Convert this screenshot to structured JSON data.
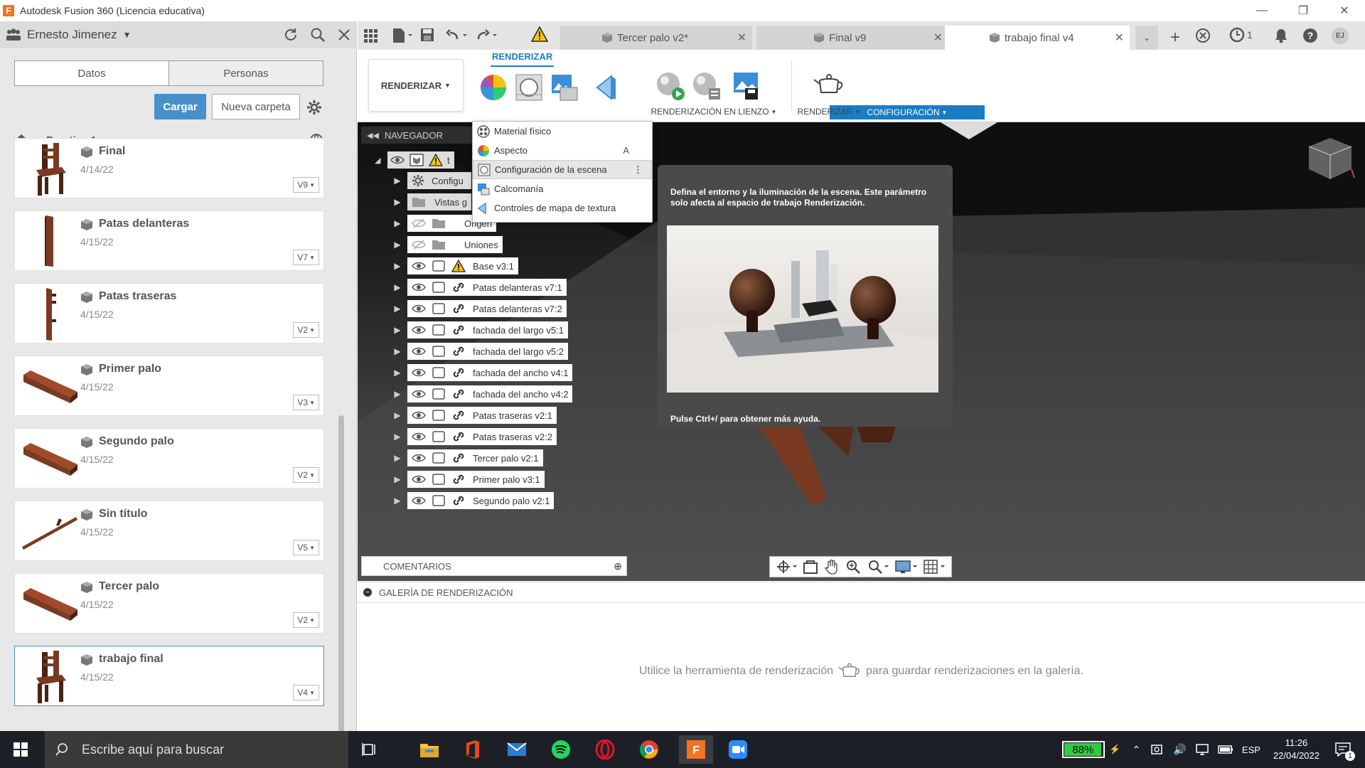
{
  "window": {
    "title": "Autodesk Fusion 360 (Licencia educativa)",
    "logo": "F"
  },
  "left": {
    "user": "Ernesto Jimenez",
    "tabs": [
      "Datos",
      "Personas"
    ],
    "upload_label": "Cargar",
    "new_folder_label": "Nueva carpeta",
    "breadcrumb": "Practica 1",
    "files": [
      {
        "name": "Final",
        "date": "4/14/22",
        "version": "V9",
        "thumb": "chair"
      },
      {
        "name": "Patas delanteras",
        "date": "4/15/22",
        "version": "V7",
        "thumb": "leg"
      },
      {
        "name": "Patas traseras",
        "date": "4/15/22",
        "version": "V2",
        "thumb": "backleg"
      },
      {
        "name": "Primer palo",
        "date": "4/15/22",
        "version": "V3",
        "thumb": "beam"
      },
      {
        "name": "Segundo palo",
        "date": "4/15/22",
        "version": "V2",
        "thumb": "beam"
      },
      {
        "name": "Sin título",
        "date": "4/15/22",
        "version": "V5",
        "thumb": "stick"
      },
      {
        "name": "Tercer palo",
        "date": "4/15/22",
        "version": "V2",
        "thumb": "beam"
      },
      {
        "name": "trabajo final",
        "date": "4/15/22",
        "version": "V4",
        "thumb": "chair"
      }
    ]
  },
  "doc_tabs": [
    {
      "label": "Tercer palo v2*",
      "active": false
    },
    {
      "label": "Final v9",
      "active": false
    },
    {
      "label": "trabajo final v4",
      "active": true
    }
  ],
  "header_icons": {
    "job_status_count": "1",
    "user_initials": "EJ"
  },
  "ribbon": {
    "workspace": "RENDERIZAR",
    "tab": "RENDERIZAR",
    "groups": [
      "CONFIGURACIÓN",
      "RENDERIZACIÓN EN LIENZO",
      "RENDERIZAR"
    ]
  },
  "menu": {
    "items": [
      {
        "label": "Material físico",
        "shortcut": ""
      },
      {
        "label": "Aspecto",
        "shortcut": "A"
      },
      {
        "label": "Configuración de la escena",
        "shortcut": ""
      },
      {
        "label": "Calcomanía",
        "shortcut": ""
      },
      {
        "label": "Controles de mapa de textura",
        "shortcut": ""
      }
    ]
  },
  "tooltip": {
    "text": "Defina el entorno y la iluminación de la escena. Este parámetro solo afecta al espacio de trabajo Renderización.",
    "help": "Pulse Ctrl+/ para obtener más ayuda."
  },
  "browser": {
    "title": "NAVEGADOR",
    "root_label": "t",
    "partial_items": [
      "Configu",
      "Vistas g"
    ],
    "items": [
      {
        "label": "Origen",
        "type": "folder",
        "hidden": true
      },
      {
        "label": "Uniones",
        "type": "folder",
        "hidden": true
      },
      {
        "label": "Base v3:1",
        "type": "warning"
      },
      {
        "label": "Patas delanteras v7:1",
        "type": "link"
      },
      {
        "label": "Patas delanteras v7:2",
        "type": "link"
      },
      {
        "label": "fachada del largo v5:1",
        "type": "link"
      },
      {
        "label": "fachada del largo v5:2",
        "type": "link"
      },
      {
        "label": "fachada del ancho v4:1",
        "type": "link"
      },
      {
        "label": "fachada del ancho v4:2",
        "type": "link"
      },
      {
        "label": "Patas traseras v2:1",
        "type": "link"
      },
      {
        "label": "Patas traseras v2:2",
        "type": "link"
      },
      {
        "label": "Tercer palo v2:1",
        "type": "link"
      },
      {
        "label": "Primer palo v3:1",
        "type": "link"
      },
      {
        "label": "Segundo palo v2:1",
        "type": "link"
      }
    ]
  },
  "comments_label": "COMENTARIOS",
  "gallery": {
    "header": "GALERÍA DE RENDERIZACIÓN",
    "msg_before": "Utilice la herramienta de renderización",
    "msg_after": "para guardar renderizaciones en la galería."
  },
  "taskbar": {
    "search_placeholder": "Escribe aquí para buscar",
    "battery": "88%",
    "lang": "ESP",
    "time": "11:26",
    "date": "22/04/2022",
    "notif": "1"
  }
}
